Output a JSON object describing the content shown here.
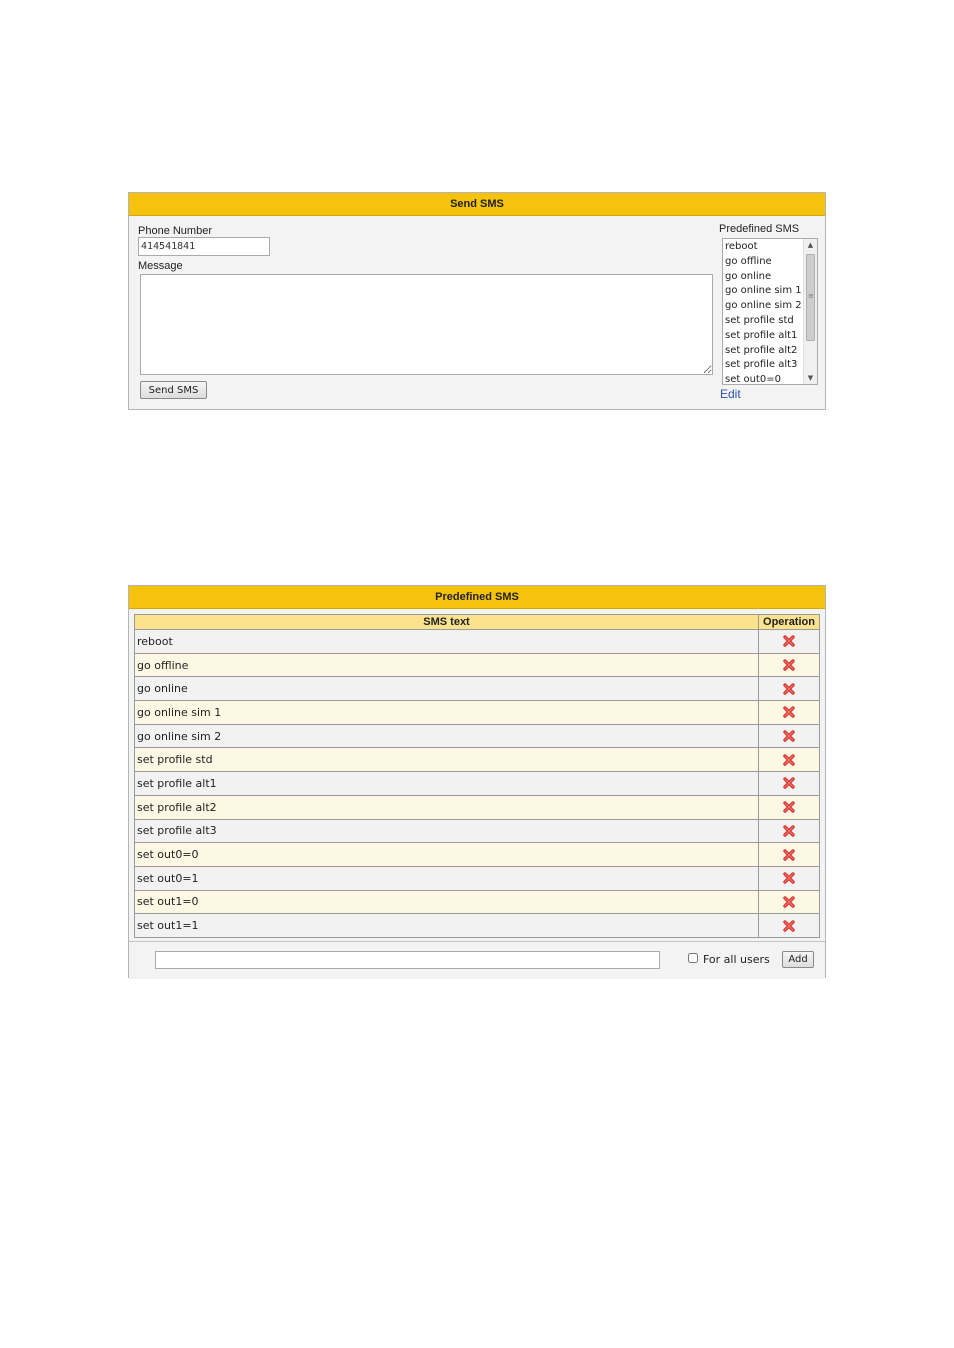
{
  "send_sms": {
    "title": "Send SMS",
    "phone_label": "Phone Number",
    "phone_value": "414541841",
    "message_label": "Message",
    "message_value": "",
    "send_button": "Send SMS",
    "predefined_label": "Predefined SMS",
    "predefined_items": [
      "reboot",
      "go offline",
      "go online",
      "go online sim 1",
      "go online sim 2",
      "set profile std",
      "set profile alt1",
      "set profile alt2",
      "set profile alt3",
      "set out0=0"
    ],
    "edit_link": "Edit"
  },
  "predefined_sms": {
    "title": "Predefined SMS",
    "columns": {
      "text": "SMS text",
      "operation": "Operation"
    },
    "rows": [
      "reboot",
      "go offline",
      "go online",
      "go online sim 1",
      "go online sim 2",
      "set profile std",
      "set profile alt1",
      "set profile alt2",
      "set profile alt3",
      "set out0=0",
      "set out0=1",
      "set out1=0",
      "set out1=1"
    ],
    "operation_icon": "delete-icon",
    "new_sms_value": "",
    "for_all_users_label": "For all users",
    "for_all_users_checked": false,
    "add_button": "Add"
  },
  "colors": {
    "header": "#f5c20d",
    "table_header": "#fbe28d",
    "row_odd": "#f2f2f2",
    "row_even": "#fdf8e3",
    "link": "#2a55b4",
    "delete": "#d9302c"
  }
}
